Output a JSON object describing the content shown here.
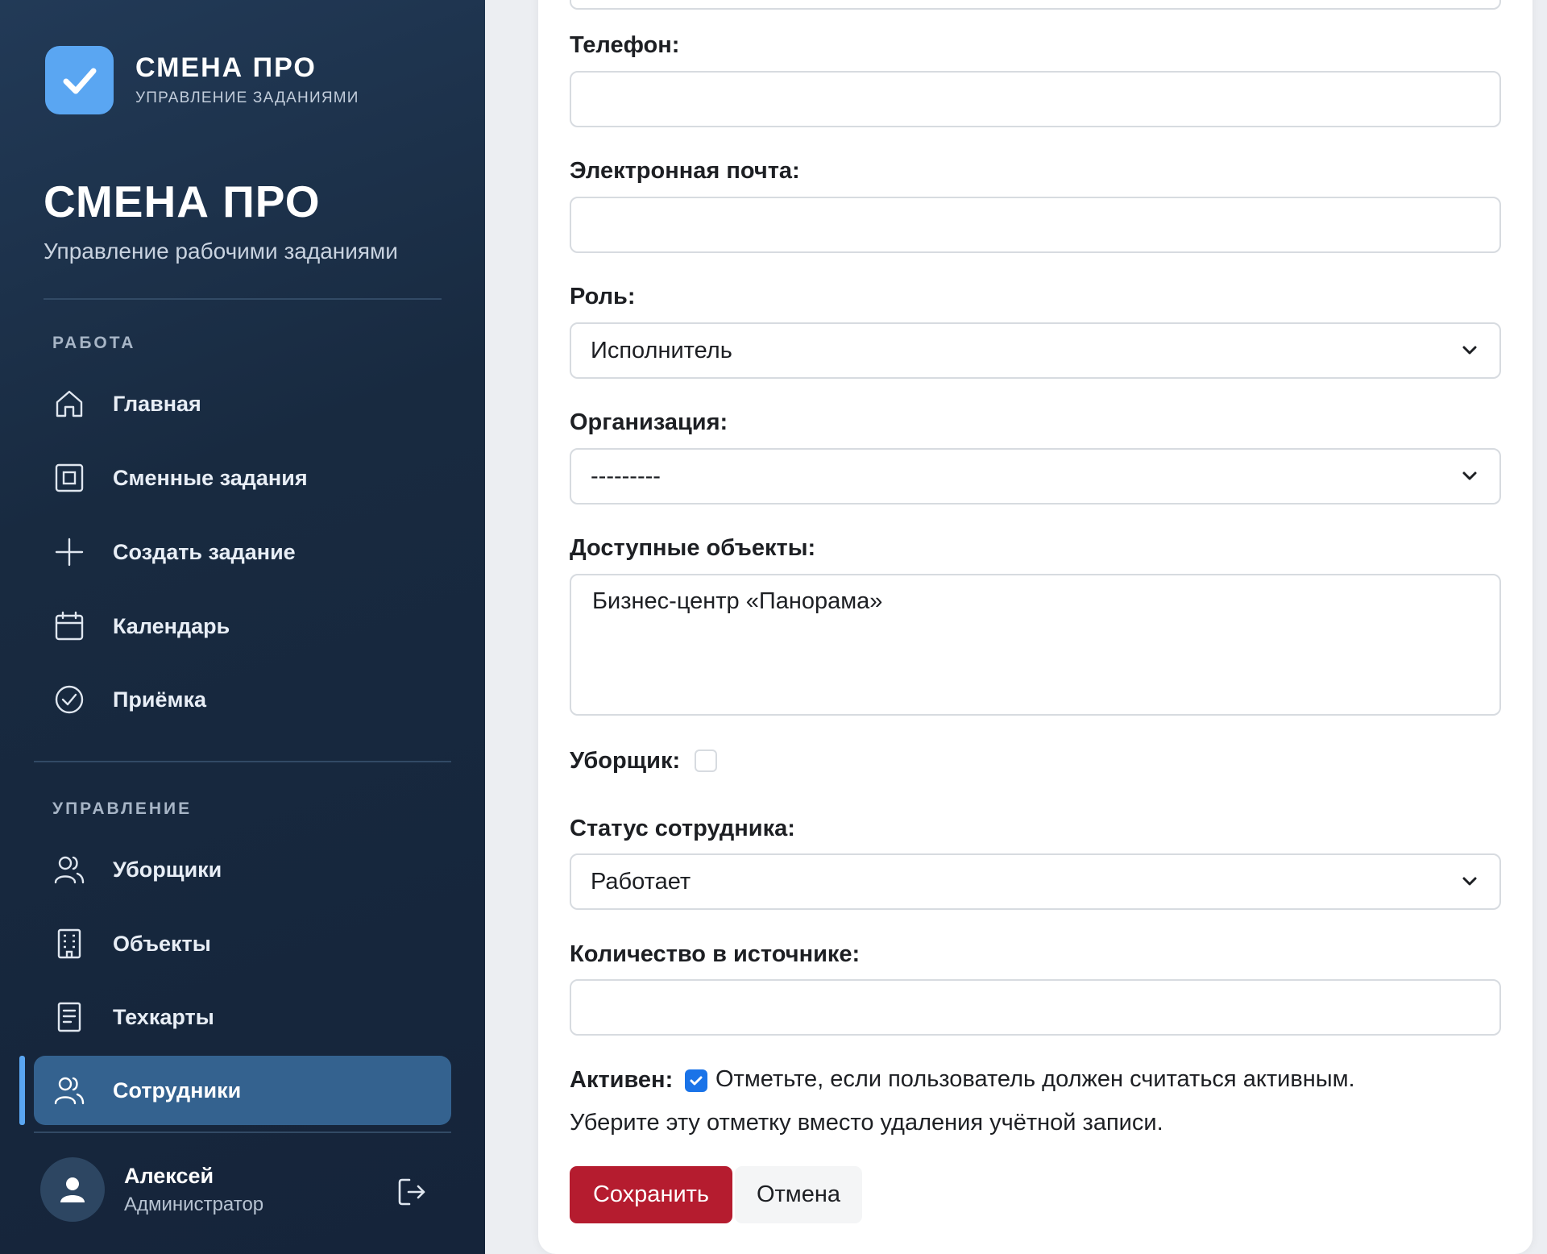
{
  "brand": {
    "title": "СМЕНА ПРО",
    "subtitle": "УПРАВЛЕНИЕ ЗАДАНИЯМИ",
    "logo_icon": "checkmark-icon",
    "logo_color": "#5aa6f2"
  },
  "app": {
    "title": "СМЕНА ПРО",
    "subtitle": "Управление рабочими заданиями"
  },
  "sidebar": {
    "sections": [
      {
        "label": "РАБОТА",
        "items": [
          {
            "label": "Главная",
            "icon": "home-icon"
          },
          {
            "label": "Сменные задания",
            "icon": "square-icon"
          },
          {
            "label": "Создать задание",
            "icon": "plus-icon"
          },
          {
            "label": "Календарь",
            "icon": "calendar-icon"
          },
          {
            "label": "Приёмка",
            "icon": "check-circle-icon"
          }
        ]
      },
      {
        "label": "УПРАВЛЕНИЕ",
        "items": [
          {
            "label": "Уборщики",
            "icon": "users-icon"
          },
          {
            "label": "Объекты",
            "icon": "building-icon"
          },
          {
            "label": "Техкарты",
            "icon": "document-icon"
          },
          {
            "label": "Сотрудники",
            "icon": "users-icon",
            "active": true
          }
        ]
      }
    ],
    "active_color": "#34628f"
  },
  "user": {
    "name": "Алексей",
    "role": "Администратор",
    "avatar_icon": "user-icon",
    "logout_icon": "logout-icon"
  },
  "form": {
    "phone": {
      "label": "Телефон:",
      "value": ""
    },
    "email": {
      "label": "Электронная почта:",
      "value": ""
    },
    "role": {
      "label": "Роль:",
      "value": "Исполнитель"
    },
    "organization": {
      "label": "Организация:",
      "value": "---------"
    },
    "objects": {
      "label": "Доступные объекты:",
      "options": [
        "Бизнес-центр «Панорама»"
      ]
    },
    "cleaner": {
      "label": "Уборщик:",
      "checked": false
    },
    "status": {
      "label": "Статус сотрудника:",
      "value": "Работает"
    },
    "source_count": {
      "label": "Количество в источнике:",
      "value": ""
    },
    "active": {
      "label": "Активен:",
      "checked": true,
      "help": "Отметьте, если пользователь должен считаться активным.",
      "help_line2": "Уберите эту отметку вместо удаления учётной записи."
    },
    "save_label": "Сохранить",
    "cancel_label": "Отмена",
    "save_color": "#b51c2f",
    "check_color": "#1a73e8"
  }
}
